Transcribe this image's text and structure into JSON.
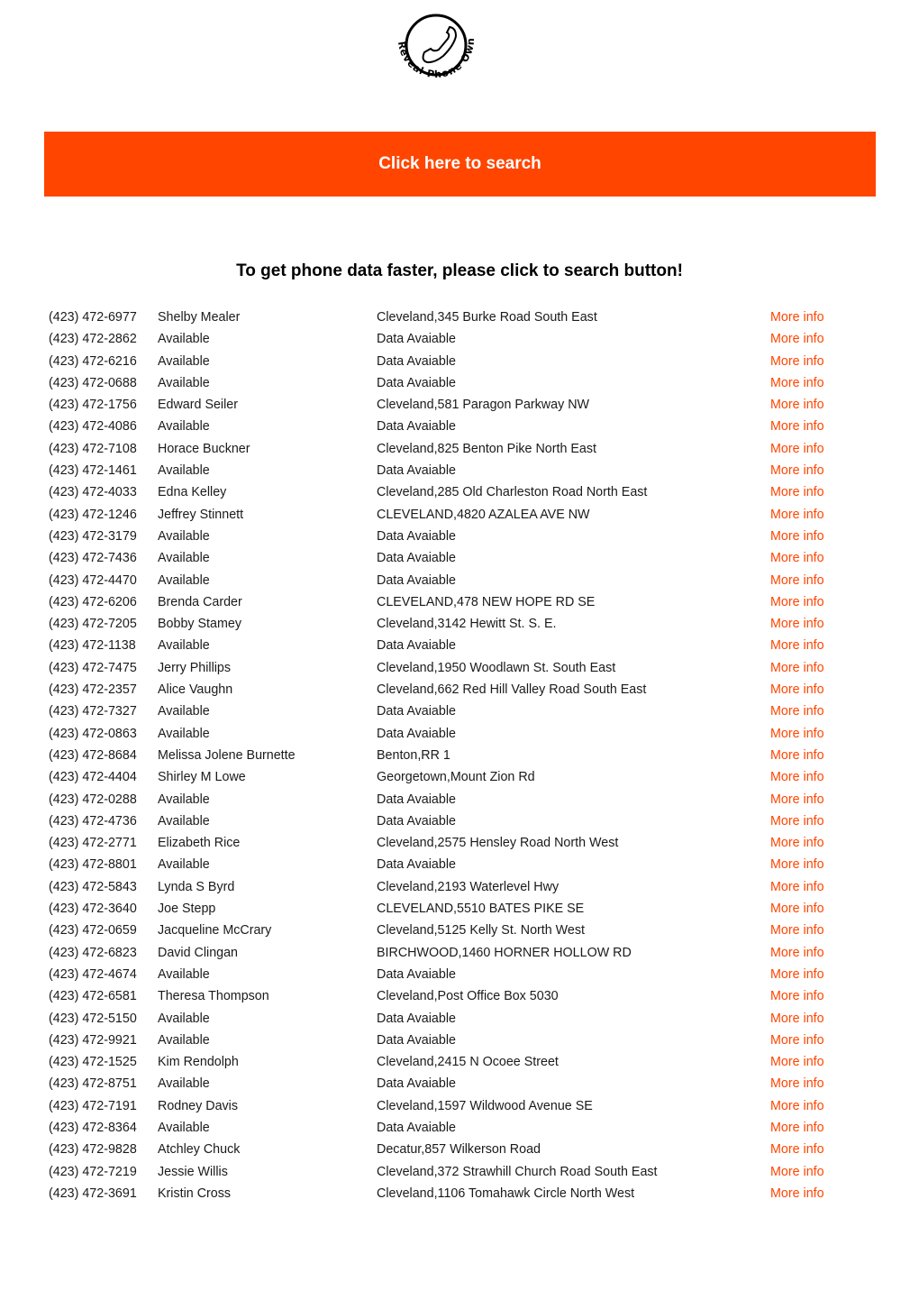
{
  "logo": {
    "text": "Reveal Phone Owner",
    "icon": "phone-handset-icon"
  },
  "banner": {
    "label": "Click here to search",
    "color": "#ff4500"
  },
  "subtitle": "To get phone data faster, please click to search button!",
  "more_info_color": "#ff4500",
  "rows": [
    {
      "phone": "(423) 472-6977",
      "name": "Shelby Mealer",
      "address": "Cleveland,345 Burke Road South East",
      "link": "More info"
    },
    {
      "phone": "(423) 472-2862",
      "name": "Available",
      "address": "Data Avaiable",
      "link": "More info"
    },
    {
      "phone": "(423) 472-6216",
      "name": "Available",
      "address": "Data Avaiable",
      "link": "More info"
    },
    {
      "phone": "(423) 472-0688",
      "name": "Available",
      "address": "Data Avaiable",
      "link": "More info"
    },
    {
      "phone": "(423) 472-1756",
      "name": "Edward Seiler",
      "address": "Cleveland,581 Paragon Parkway NW",
      "link": "More info"
    },
    {
      "phone": "(423) 472-4086",
      "name": "Available",
      "address": "Data Avaiable",
      "link": "More info"
    },
    {
      "phone": "(423) 472-7108",
      "name": "Horace Buckner",
      "address": "Cleveland,825 Benton Pike North East",
      "link": "More info"
    },
    {
      "phone": "(423) 472-1461",
      "name": "Available",
      "address": "Data Avaiable",
      "link": "More info"
    },
    {
      "phone": "(423) 472-4033",
      "name": "Edna Kelley",
      "address": "Cleveland,285 Old Charleston Road North East",
      "link": "More info"
    },
    {
      "phone": "(423) 472-1246",
      "name": "Jeffrey Stinnett",
      "address": "CLEVELAND,4820 AZALEA AVE NW",
      "link": "More info"
    },
    {
      "phone": "(423) 472-3179",
      "name": "Available",
      "address": "Data Avaiable",
      "link": "More info"
    },
    {
      "phone": "(423) 472-7436",
      "name": "Available",
      "address": "Data Avaiable",
      "link": "More info"
    },
    {
      "phone": "(423) 472-4470",
      "name": "Available",
      "address": "Data Avaiable",
      "link": "More info"
    },
    {
      "phone": "(423) 472-6206",
      "name": "Brenda Carder",
      "address": "CLEVELAND,478 NEW HOPE RD SE",
      "link": "More info"
    },
    {
      "phone": "(423) 472-7205",
      "name": "Bobby Stamey",
      "address": "Cleveland,3142 Hewitt St. S. E.",
      "link": "More info"
    },
    {
      "phone": "(423) 472-1138",
      "name": "Available",
      "address": "Data Avaiable",
      "link": "More info"
    },
    {
      "phone": "(423) 472-7475",
      "name": "Jerry Phillips",
      "address": "Cleveland,1950 Woodlawn St. South East",
      "link": "More info"
    },
    {
      "phone": "(423) 472-2357",
      "name": "Alice Vaughn",
      "address": "Cleveland,662 Red Hill Valley Road South East",
      "link": "More info"
    },
    {
      "phone": "(423) 472-7327",
      "name": "Available",
      "address": "Data Avaiable",
      "link": "More info"
    },
    {
      "phone": "(423) 472-0863",
      "name": "Available",
      "address": "Data Avaiable",
      "link": "More info"
    },
    {
      "phone": "(423) 472-8684",
      "name": "Melissa Jolene Burnette",
      "address": "Benton,RR 1",
      "link": "More info"
    },
    {
      "phone": "(423) 472-4404",
      "name": "Shirley M Lowe",
      "address": "Georgetown,Mount Zion Rd",
      "link": "More info"
    },
    {
      "phone": "(423) 472-0288",
      "name": "Available",
      "address": "Data Avaiable",
      "link": "More info"
    },
    {
      "phone": "(423) 472-4736",
      "name": "Available",
      "address": "Data Avaiable",
      "link": "More info"
    },
    {
      "phone": "(423) 472-2771",
      "name": "Elizabeth Rice",
      "address": "Cleveland,2575 Hensley Road North West",
      "link": "More info"
    },
    {
      "phone": "(423) 472-8801",
      "name": "Available",
      "address": "Data Avaiable",
      "link": "More info"
    },
    {
      "phone": "(423) 472-5843",
      "name": "Lynda S Byrd",
      "address": "Cleveland,2193 Waterlevel Hwy",
      "link": "More info"
    },
    {
      "phone": "(423) 472-3640",
      "name": "Joe Stepp",
      "address": "CLEVELAND,5510 BATES PIKE SE",
      "link": "More info"
    },
    {
      "phone": "(423) 472-0659",
      "name": "Jacqueline McCrary",
      "address": "Cleveland,5125 Kelly St. North West",
      "link": "More info"
    },
    {
      "phone": "(423) 472-6823",
      "name": "David Clingan",
      "address": "BIRCHWOOD,1460 HORNER HOLLOW RD",
      "link": "More info"
    },
    {
      "phone": "(423) 472-4674",
      "name": "Available",
      "address": "Data Avaiable",
      "link": "More info"
    },
    {
      "phone": "(423) 472-6581",
      "name": "Theresa Thompson",
      "address": "Cleveland,Post Office Box 5030",
      "link": "More info"
    },
    {
      "phone": "(423) 472-5150",
      "name": "Available",
      "address": "Data Avaiable",
      "link": "More info"
    },
    {
      "phone": "(423) 472-9921",
      "name": "Available",
      "address": "Data Avaiable",
      "link": "More info"
    },
    {
      "phone": "(423) 472-1525",
      "name": "Kim Rendolph",
      "address": "Cleveland,2415 N Ocoee Street",
      "link": "More info"
    },
    {
      "phone": "(423) 472-8751",
      "name": "Available",
      "address": "Data Avaiable",
      "link": "More info"
    },
    {
      "phone": "(423) 472-7191",
      "name": "Rodney Davis",
      "address": "Cleveland,1597 Wildwood Avenue SE",
      "link": "More info"
    },
    {
      "phone": "(423) 472-8364",
      "name": "Available",
      "address": "Data Avaiable",
      "link": "More info"
    },
    {
      "phone": "(423) 472-9828",
      "name": "Atchley Chuck",
      "address": "Decatur,857 Wilkerson Road",
      "link": "More info"
    },
    {
      "phone": "(423) 472-7219",
      "name": "Jessie Willis",
      "address": "Cleveland,372 Strawhill Church Road South East",
      "link": "More info"
    },
    {
      "phone": "(423) 472-3691",
      "name": "Kristin Cross",
      "address": "Cleveland,1106 Tomahawk Circle North West",
      "link": "More info"
    }
  ]
}
